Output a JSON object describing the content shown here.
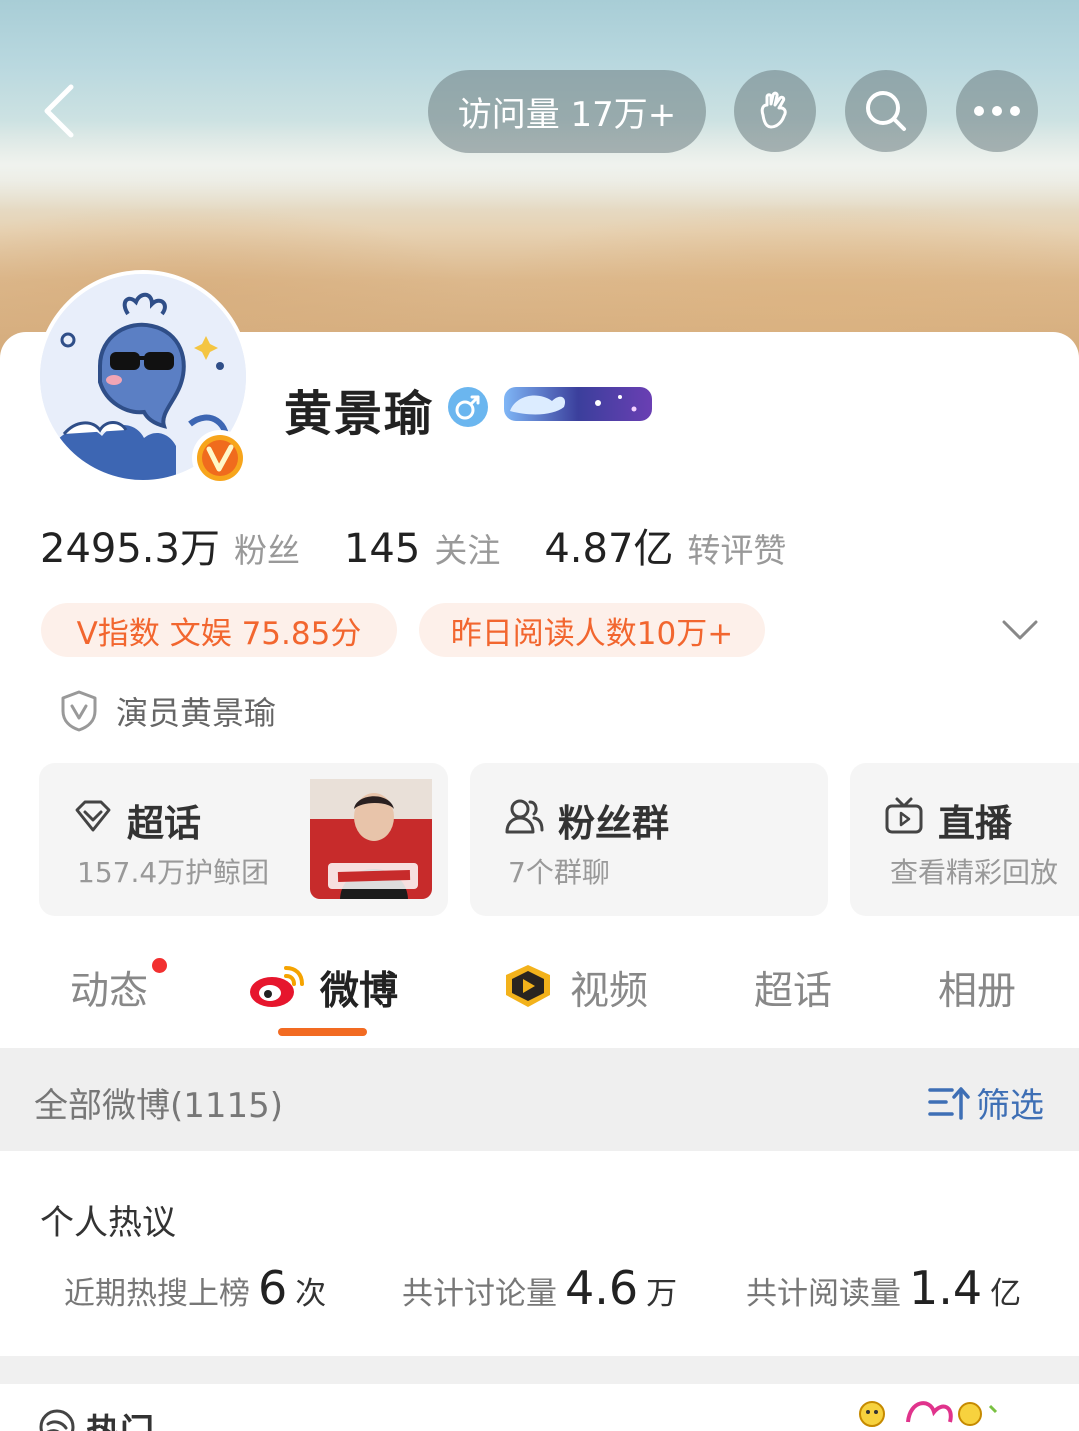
{
  "header": {
    "visits_label": "访问量 17万+"
  },
  "profile": {
    "name": "黄景瑜",
    "stats": [
      {
        "value": "2495.3万",
        "label": "粉丝"
      },
      {
        "value": "145",
        "label": "关注"
      },
      {
        "value": "4.87亿",
        "label": "转评赞"
      }
    ],
    "tags": [
      "V指数 文娱 75.85分",
      "昨日阅读人数10万+"
    ],
    "certification": "演员黄景瑜"
  },
  "entries": [
    {
      "title": "超话",
      "subtitle": "157.4万护鲸团",
      "icon": "diamond-icon"
    },
    {
      "title": "粉丝群",
      "subtitle": "7个群聊",
      "icon": "group-icon"
    },
    {
      "title": "直播",
      "subtitle": "查看精彩回放",
      "icon": "tv-icon"
    }
  ],
  "tabs": [
    {
      "label": "动态"
    },
    {
      "label": "微博"
    },
    {
      "label": "视频"
    },
    {
      "label": "超话"
    },
    {
      "label": "相册"
    }
  ],
  "feed": {
    "all_count_label": "全部微博(1115)",
    "filter_label": "筛选"
  },
  "hot": {
    "title": "个人热议",
    "items": [
      {
        "label": "近期热搜上榜",
        "value": "6",
        "unit": "次"
      },
      {
        "label": "共计讨论量",
        "value": "4.6",
        "unit": "万"
      },
      {
        "label": "共计阅读量",
        "value": "1.4",
        "unit": "亿"
      }
    ]
  },
  "bottom": {
    "title": "热门"
  },
  "colors": {
    "accent_orange": "#f26b22",
    "tag_text": "#f2662f",
    "tag_bg": "#fdf0ea",
    "link_blue": "#3e6fb5"
  }
}
